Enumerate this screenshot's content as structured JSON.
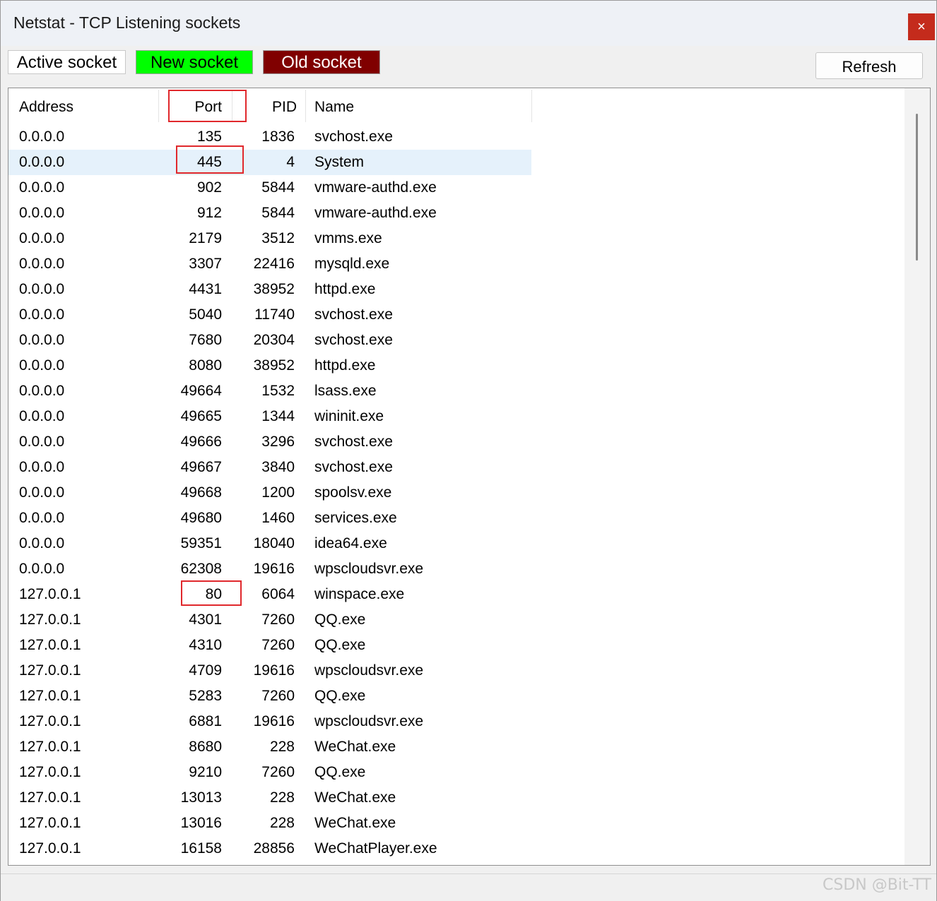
{
  "window": {
    "title": "Netstat - TCP Listening sockets",
    "close_icon": "×"
  },
  "legend": {
    "active": "Active socket",
    "new": "New socket",
    "old": "Old socket",
    "colors": {
      "active": "#ffffff",
      "new": "#00ff00",
      "old": "#800000"
    }
  },
  "toolbar": {
    "refresh_label": "Refresh"
  },
  "table": {
    "columns": {
      "address": "Address",
      "port": "Port",
      "pid": "PID",
      "name": "Name"
    },
    "rows": [
      {
        "address": "0.0.0.0",
        "port": "135",
        "pid": "1836",
        "name": "svchost.exe"
      },
      {
        "address": "0.0.0.0",
        "port": "445",
        "pid": "4",
        "name": "System"
      },
      {
        "address": "0.0.0.0",
        "port": "902",
        "pid": "5844",
        "name": "vmware-authd.exe"
      },
      {
        "address": "0.0.0.0",
        "port": "912",
        "pid": "5844",
        "name": "vmware-authd.exe"
      },
      {
        "address": "0.0.0.0",
        "port": "2179",
        "pid": "3512",
        "name": "vmms.exe"
      },
      {
        "address": "0.0.0.0",
        "port": "3307",
        "pid": "22416",
        "name": "mysqld.exe"
      },
      {
        "address": "0.0.0.0",
        "port": "4431",
        "pid": "38952",
        "name": "httpd.exe"
      },
      {
        "address": "0.0.0.0",
        "port": "5040",
        "pid": "11740",
        "name": "svchost.exe"
      },
      {
        "address": "0.0.0.0",
        "port": "7680",
        "pid": "20304",
        "name": "svchost.exe"
      },
      {
        "address": "0.0.0.0",
        "port": "8080",
        "pid": "38952",
        "name": "httpd.exe"
      },
      {
        "address": "0.0.0.0",
        "port": "49664",
        "pid": "1532",
        "name": "lsass.exe"
      },
      {
        "address": "0.0.0.0",
        "port": "49665",
        "pid": "1344",
        "name": "wininit.exe"
      },
      {
        "address": "0.0.0.0",
        "port": "49666",
        "pid": "3296",
        "name": "svchost.exe"
      },
      {
        "address": "0.0.0.0",
        "port": "49667",
        "pid": "3840",
        "name": "svchost.exe"
      },
      {
        "address": "0.0.0.0",
        "port": "49668",
        "pid": "1200",
        "name": "spoolsv.exe"
      },
      {
        "address": "0.0.0.0",
        "port": "49680",
        "pid": "1460",
        "name": "services.exe"
      },
      {
        "address": "0.0.0.0",
        "port": "59351",
        "pid": "18040",
        "name": "idea64.exe"
      },
      {
        "address": "0.0.0.0",
        "port": "62308",
        "pid": "19616",
        "name": "wpscloudsvr.exe"
      },
      {
        "address": "127.0.0.1",
        "port": "80",
        "pid": "6064",
        "name": "winspace.exe"
      },
      {
        "address": "127.0.0.1",
        "port": "4301",
        "pid": "7260",
        "name": "QQ.exe"
      },
      {
        "address": "127.0.0.1",
        "port": "4310",
        "pid": "7260",
        "name": "QQ.exe"
      },
      {
        "address": "127.0.0.1",
        "port": "4709",
        "pid": "19616",
        "name": "wpscloudsvr.exe"
      },
      {
        "address": "127.0.0.1",
        "port": "5283",
        "pid": "7260",
        "name": "QQ.exe"
      },
      {
        "address": "127.0.0.1",
        "port": "6881",
        "pid": "19616",
        "name": "wpscloudsvr.exe"
      },
      {
        "address": "127.0.0.1",
        "port": "8680",
        "pid": "228",
        "name": "WeChat.exe"
      },
      {
        "address": "127.0.0.1",
        "port": "9210",
        "pid": "7260",
        "name": "QQ.exe"
      },
      {
        "address": "127.0.0.1",
        "port": "13013",
        "pid": "228",
        "name": "WeChat.exe"
      },
      {
        "address": "127.0.0.1",
        "port": "13016",
        "pid": "228",
        "name": "WeChat.exe"
      },
      {
        "address": "127.0.0.1",
        "port": "16158",
        "pid": "28856",
        "name": "WeChatPlayer.exe"
      }
    ],
    "selected_row": 1
  },
  "watermark": "CSDN @Bit-TT"
}
